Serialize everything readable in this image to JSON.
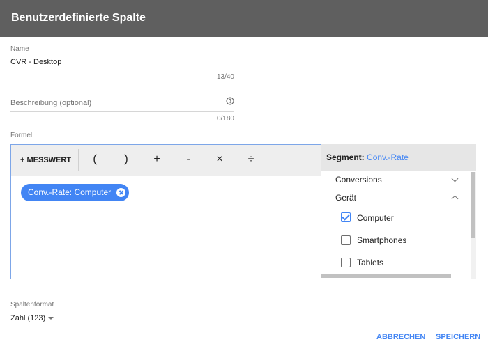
{
  "dialog": {
    "title": "Benutzerdefinierte Spalte"
  },
  "name_field": {
    "label": "Name",
    "value": "CVR - Desktop",
    "counter": "13/40"
  },
  "description_field": {
    "label": "Beschreibung (optional)",
    "counter": "0/180",
    "help_icon": "help-circle-icon"
  },
  "formula": {
    "label": "Formel",
    "toolbar": {
      "metric_button": "+ MESSWERT",
      "operators": [
        "(",
        ")",
        "+",
        "-",
        "×",
        "÷"
      ]
    },
    "chip": {
      "label": "Conv.-Rate: Computer",
      "remove_icon": "close-circle-icon"
    }
  },
  "segment": {
    "title": "Segment:",
    "value": "Conv.-Rate",
    "categories": [
      {
        "label": "Conversions",
        "expanded": false
      },
      {
        "label": "Gerät",
        "expanded": true
      }
    ],
    "options": [
      {
        "label": "Computer",
        "checked": true
      },
      {
        "label": "Smartphones",
        "checked": false
      },
      {
        "label": "Tablets",
        "checked": false
      }
    ]
  },
  "column_format": {
    "label": "Spaltenformat",
    "value": "Zahl (123)"
  },
  "actions": {
    "cancel": "ABBRECHEN",
    "save": "SPEICHERN"
  },
  "colors": {
    "accent": "#4285f4",
    "header": "#5f5f5f"
  }
}
